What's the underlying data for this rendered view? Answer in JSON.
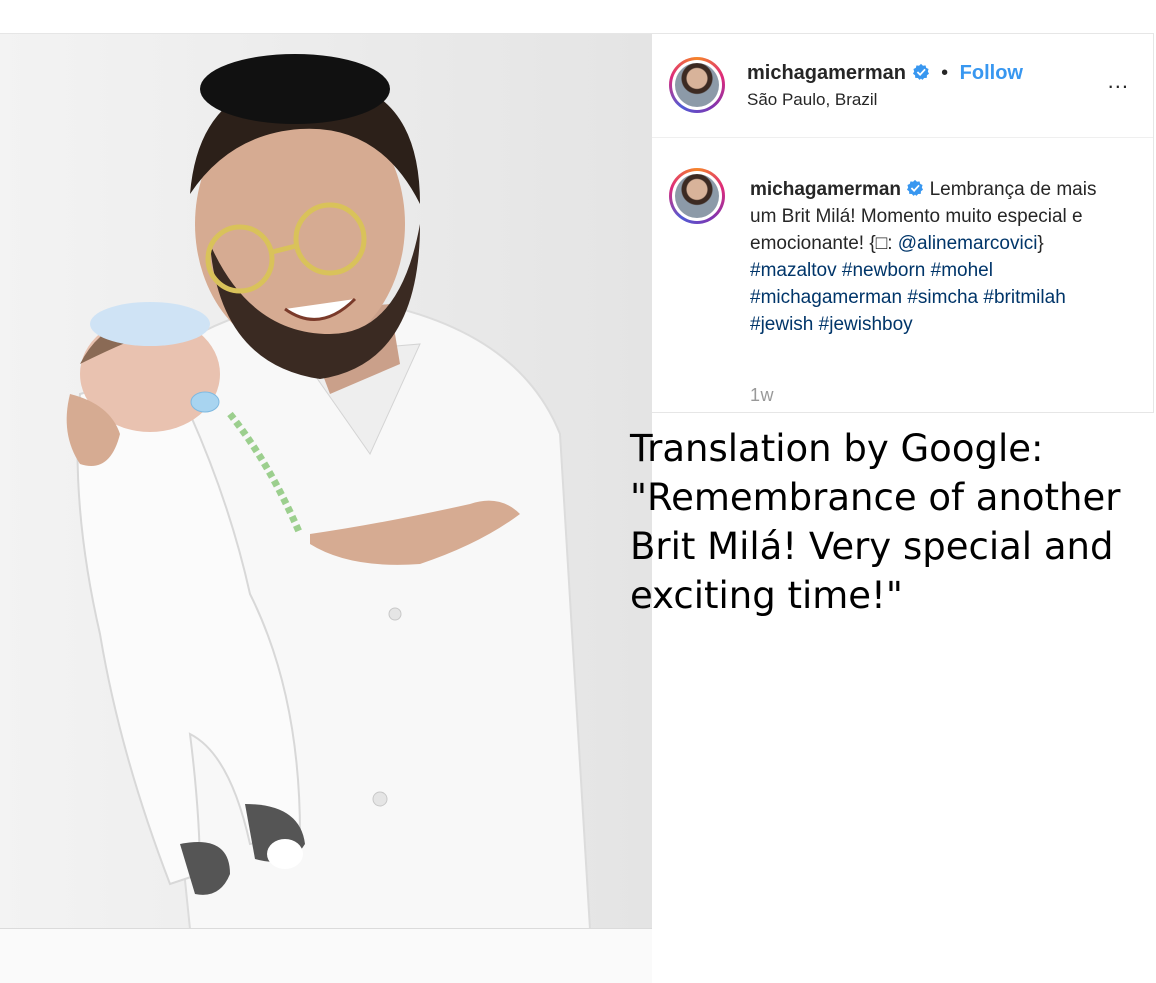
{
  "post": {
    "username": "michagamerman",
    "follow_label": "Follow",
    "separator": "•",
    "location": "São Paulo, Brazil",
    "more_label": "...",
    "caption": {
      "text_line1": "Lembrança de mais um Brit Milá! Momento muito especial e emocionante! {",
      "emoji_placeholder": "□",
      "colon": ":",
      "mention": "@alinemarcovici",
      "close": "}",
      "hashtags": [
        "#mazaltov",
        "#newborn",
        "#mohel",
        "#michagamerman",
        "#simcha",
        "#britmilah",
        "#jewish",
        "#jewishboy"
      ]
    },
    "timestamp": "1w"
  },
  "overlay": {
    "translation": "Translation by Google: \"Remembrance of another Brit Milá! Very special and exciting time!\""
  },
  "colors": {
    "link": "#003569",
    "follow": "#3897f0",
    "verified": "#3897f0"
  }
}
